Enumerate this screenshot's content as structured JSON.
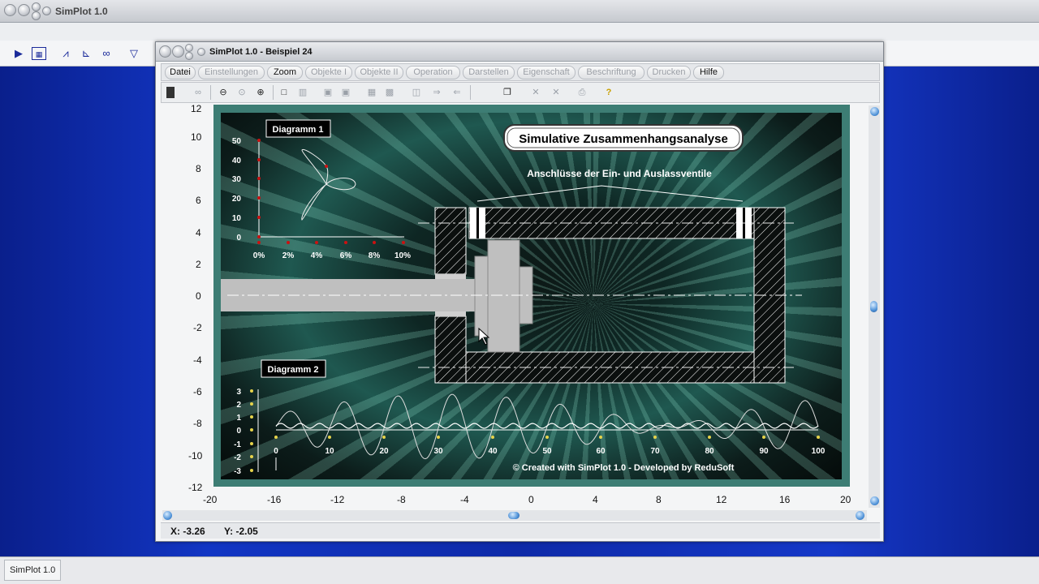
{
  "app": {
    "title": "SimPlot 1.0",
    "taskbar_item": "SimPlot 1.0"
  },
  "window": {
    "title": "SimPlot 1.0 - Beispiel 24",
    "menu": [
      "Datei",
      "Einstellungen",
      "Zoom",
      "Objekte I",
      "Objekte II",
      "Operation",
      "Darstellen",
      "Eigenschaft",
      "Beschriftung",
      "Drucken",
      "Hilfe"
    ],
    "menu_active": [
      "Datei",
      "Zoom",
      "Hilfe"
    ]
  },
  "axes": {
    "y_ticks": [
      "12",
      "10",
      "8",
      "6",
      "4",
      "2",
      "0",
      "-2",
      "-4",
      "-6",
      "-8",
      "-10",
      "-12"
    ],
    "x_ticks": [
      "-20",
      "-16",
      "-12",
      "-8",
      "-4",
      "0",
      "4",
      "8",
      "12",
      "16",
      "20"
    ]
  },
  "plot": {
    "title": "Simulative Zusammenhangsanalyse",
    "subtitle": "Anschlüsse der Ein- und Auslassventile",
    "credit": "© Created with SimPlot 1.0 - Developed by ReduSoft",
    "diagram1": {
      "label": "Diagramm 1",
      "y_ticks": [
        "50",
        "40",
        "30",
        "20",
        "10",
        "0"
      ],
      "x_ticks": [
        "0%",
        "2%",
        "4%",
        "6%",
        "8%",
        "10%"
      ]
    },
    "diagram2": {
      "label": "Diagramm 2",
      "y_ticks": [
        "3",
        "2",
        "1",
        "0",
        "-1",
        "-2",
        "-3"
      ],
      "x_ticks": [
        "0",
        "10",
        "20",
        "30",
        "40",
        "50",
        "60",
        "70",
        "80",
        "90",
        "100"
      ]
    }
  },
  "status": {
    "x": "X:  -3.26",
    "y": "Y:  -2.05"
  },
  "colors": {
    "frame": "#3d7d74",
    "desktop": "#1236c4"
  }
}
